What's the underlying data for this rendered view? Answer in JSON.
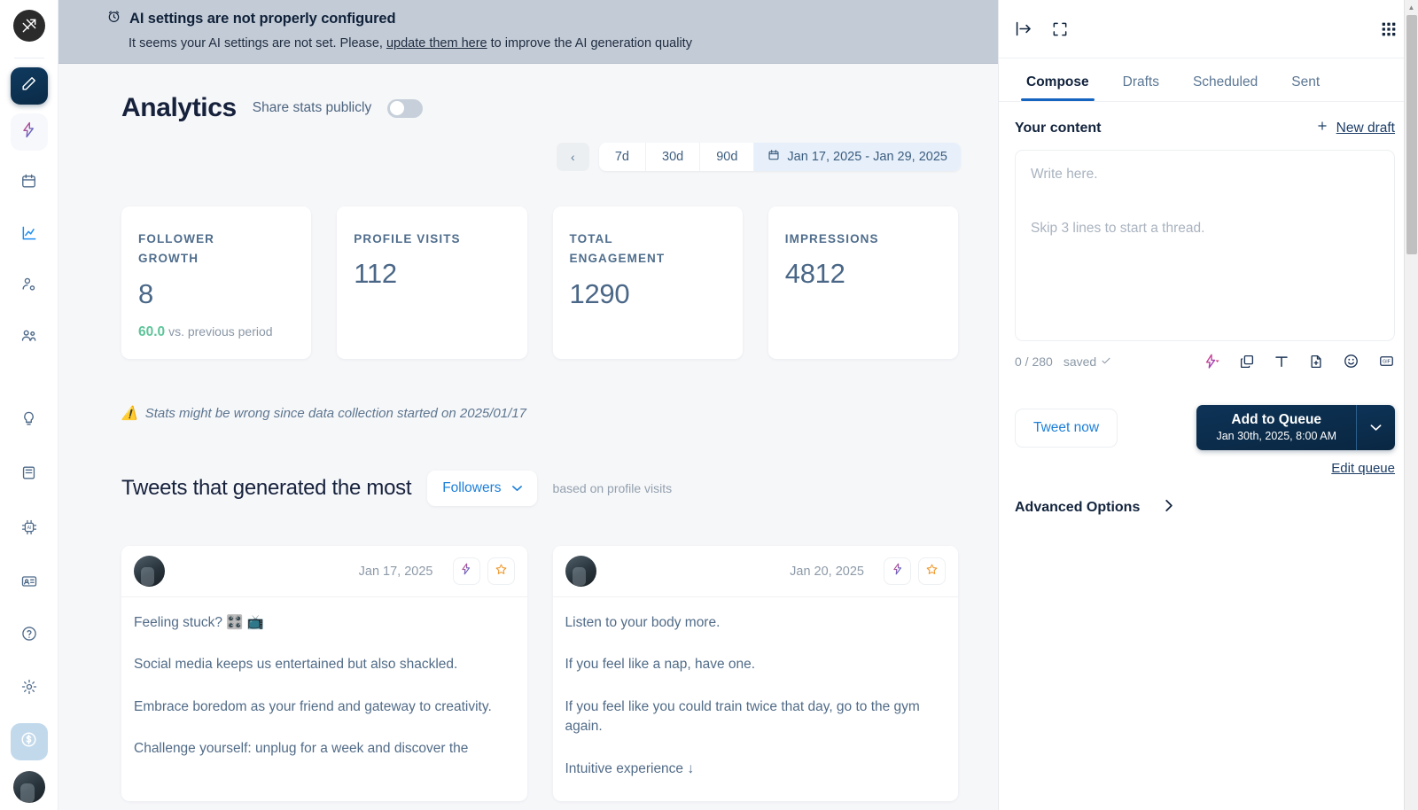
{
  "banner": {
    "icon": "alarm-clock-icon",
    "title": "AI settings are not properly configured",
    "sub_before": "It seems your AI settings are not set. Please, ",
    "link": "update them here",
    "sub_after": " to improve the AI generation quality"
  },
  "sidebar": {
    "logo": "app-logo-icon",
    "items": [
      {
        "name": "compose",
        "icon": "pencil-icon"
      },
      {
        "name": "ai-assistant",
        "icon": "lightning-icon"
      },
      {
        "name": "calendar",
        "icon": "calendar-icon"
      },
      {
        "name": "analytics",
        "icon": "chart-line-icon"
      },
      {
        "name": "audience",
        "icon": "user-settings-icon"
      },
      {
        "name": "engage",
        "icon": "users-group-icon"
      },
      {
        "name": "ideas",
        "icon": "lightbulb-icon"
      },
      {
        "name": "library",
        "icon": "book-icon"
      },
      {
        "name": "ai-chip",
        "icon": "ai-chip-icon"
      },
      {
        "name": "profile-card",
        "icon": "id-card-icon"
      },
      {
        "name": "help",
        "icon": "question-circle-icon"
      },
      {
        "name": "settings",
        "icon": "gear-icon"
      },
      {
        "name": "billing",
        "icon": "dollar-circle-icon"
      }
    ],
    "avatar": "user-avatar"
  },
  "analytics": {
    "title": "Analytics",
    "share_label": "Share stats publicly",
    "share_enabled": false,
    "range": {
      "prev_icon": "chevron-left-icon",
      "options": [
        "7d",
        "30d",
        "90d"
      ],
      "calendar_icon": "calendar-icon",
      "selected_date": "Jan 17, 2025 - Jan 29, 2025"
    },
    "cards": [
      {
        "label": "FOLLOWER GROWTH",
        "value": "8",
        "delta": "60.0",
        "delta_note": "vs. previous period",
        "delta_color": "#5fc49a"
      },
      {
        "label": "PROFILE VISITS",
        "value": "112"
      },
      {
        "label": "TOTAL ENGAGEMENT",
        "value": "1290"
      },
      {
        "label": "IMPRESSIONS",
        "value": "4812"
      }
    ],
    "notice_icon": "warning-icon",
    "notice": "Stats might be wrong since data collection started on 2025/01/17",
    "section": {
      "title": "Tweets that generated the most",
      "metric": "Followers",
      "metric_caret": "chevron-down-icon",
      "subtitle": "based on profile visits"
    },
    "tweets": [
      {
        "avatar": "tweet-author-avatar",
        "date": "Jan 17, 2025",
        "ai_icon": "lightning-icon",
        "star_icon": "star-icon",
        "lines": [
          "Feeling stuck? 🎛️ 📺",
          "Social media keeps us entertained but also shackled.",
          "Embrace boredom as your friend and gateway to creativity.",
          "Challenge yourself: unplug for a week and discover the"
        ]
      },
      {
        "avatar": "tweet-author-avatar",
        "date": "Jan 20, 2025",
        "ai_icon": "lightning-icon",
        "star_icon": "star-icon",
        "lines": [
          "Listen to your body more.",
          "If you feel like a nap, have one.",
          "If you feel like you could train twice that day, go to the gym again.",
          "Intuitive experience ↓"
        ]
      }
    ]
  },
  "right_panel": {
    "top_icons": [
      "panel-collapse-icon",
      "expand-fullscreen-icon",
      "apps-grid-icon"
    ],
    "tabs": [
      {
        "label": "Compose",
        "active": true
      },
      {
        "label": "Drafts",
        "active": false
      },
      {
        "label": "Scheduled",
        "active": false
      },
      {
        "label": "Sent",
        "active": false
      }
    ],
    "content_title": "Your content",
    "new_draft": {
      "plus_icon": "plus-icon",
      "label": "New draft"
    },
    "composer": {
      "value": "",
      "placeholder_1": "Write here.",
      "placeholder_2": "Skip 3 lines to start a thread."
    },
    "counter": "0 / 280",
    "saved": "saved",
    "saved_icon": "check-icon",
    "tool_icons": [
      "ai-lightning-dropdown-icon",
      "duplicate-icon",
      "text-format-icon",
      "add-file-icon",
      "emoji-icon",
      "gif-icon"
    ],
    "tweet_now": "Tweet now",
    "queue": {
      "primary": "Add to Queue",
      "secondary": "Jan 30th, 2025, 8:00 AM",
      "caret_icon": "chevron-down-icon"
    },
    "edit_queue": "Edit queue",
    "advanced_options": "Advanced Options",
    "advanced_caret": "chevron-right-icon"
  },
  "floating": {
    "ai_icon": "lightning-icon",
    "panel_icon": "panel-toggle-icon"
  },
  "colors": {
    "accent_blue": "#1d7fd8",
    "dark_navy": "#0b2b47",
    "banner_bg": "#c3cbd6",
    "positive_green": "#5fc49a",
    "page_bg": "#f6f7f9"
  }
}
